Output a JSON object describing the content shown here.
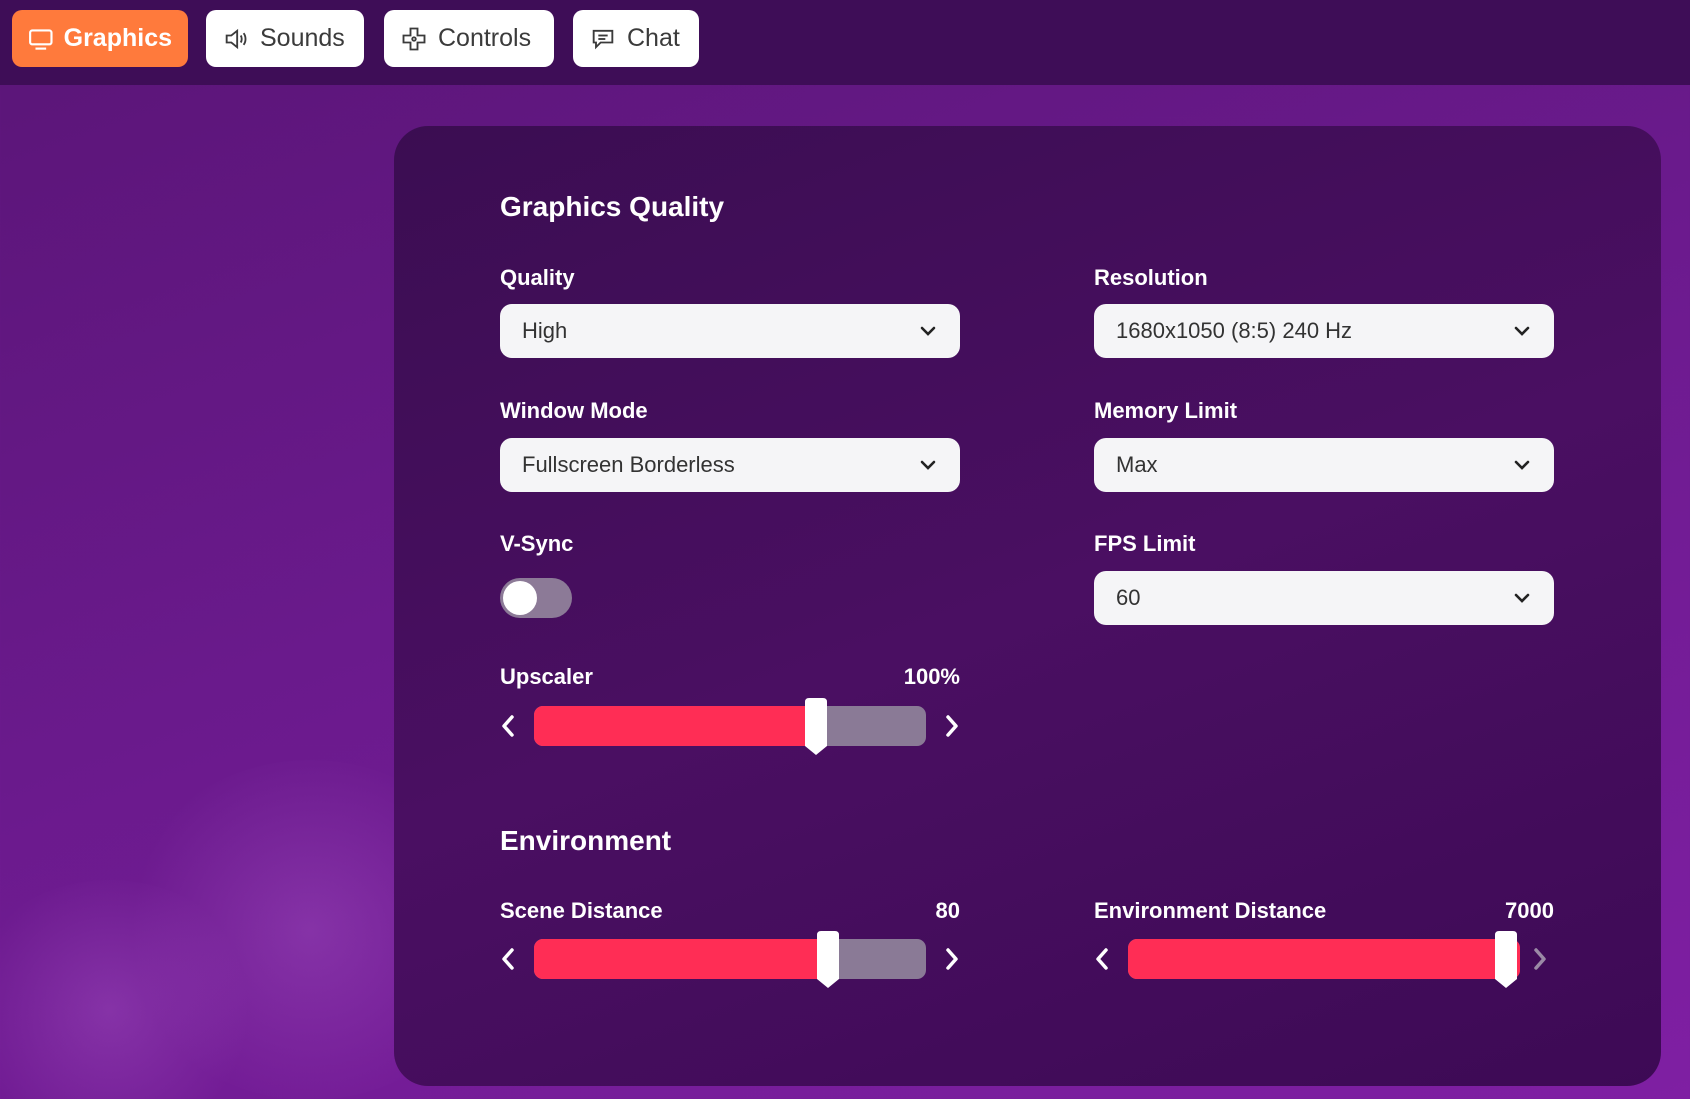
{
  "tabs": [
    {
      "label": "Graphics",
      "icon": "monitor-icon",
      "active": true
    },
    {
      "label": "Sounds",
      "icon": "speaker-icon",
      "active": false
    },
    {
      "label": "Controls",
      "icon": "gamepad-icon",
      "active": false
    },
    {
      "label": "Chat",
      "icon": "chat-bubble-icon",
      "active": false
    }
  ],
  "graphics": {
    "title": "Graphics Quality",
    "quality": {
      "label": "Quality",
      "value": "High"
    },
    "resolution": {
      "label": "Resolution",
      "value": "1680x1050 (8:5) 240 Hz"
    },
    "window_mode": {
      "label": "Window Mode",
      "value": "Fullscreen Borderless"
    },
    "memory_limit": {
      "label": "Memory Limit",
      "value": "Max"
    },
    "vsync": {
      "label": "V-Sync",
      "enabled": false
    },
    "fps_limit": {
      "label": "FPS Limit",
      "value": "60"
    },
    "upscaler": {
      "label": "Upscaler",
      "value_text": "100%",
      "slider_fraction": 0.72
    }
  },
  "environment": {
    "title": "Environment",
    "scene_distance": {
      "label": "Scene Distance",
      "value_text": "80",
      "slider_fraction": 0.75
    },
    "environment_distance": {
      "label": "Environment Distance",
      "value_text": "7000",
      "slider_fraction": 1.0
    }
  },
  "colors": {
    "accent_tab": "#ff7a3c",
    "slider_fill": "#ff2d55",
    "slider_track": "#8a7a96",
    "panel": "#420e5a",
    "topbar": "#3e0d57"
  }
}
